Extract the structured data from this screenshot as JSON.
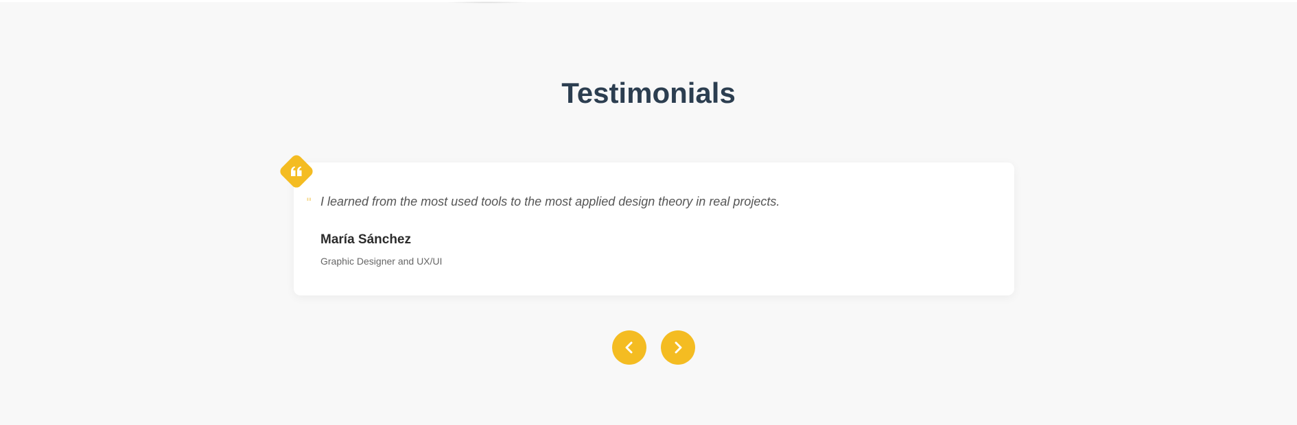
{
  "section": {
    "title": "Testimonials"
  },
  "testimonial": {
    "quote": "I learned from the most used tools to the most applied design theory in real projects.",
    "author_name": "María Sánchez",
    "author_role": "Graphic Designer and UX/UI"
  },
  "icons": {
    "badge": "quote-left-icon",
    "inline_quote": "quote-mark-icon",
    "prev": "chevron-left-icon",
    "next": "chevron-right-icon"
  },
  "colors": {
    "background": "#f8f8f8",
    "card": "#ffffff",
    "accent": "#f4bc22",
    "title": "#2c3e50",
    "quote_text": "#555555",
    "author_name": "#2b2b2b",
    "author_role": "#666666"
  }
}
